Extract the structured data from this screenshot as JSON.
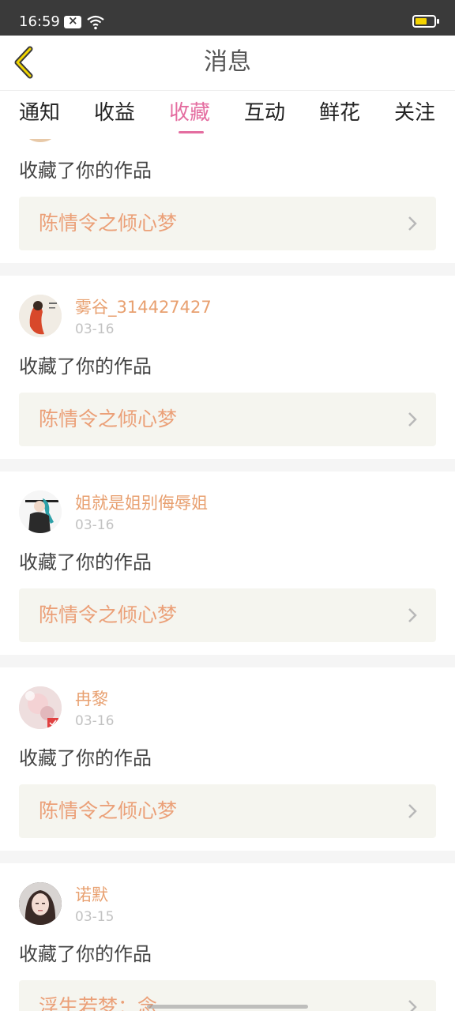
{
  "status_bar": {
    "time": "16:59"
  },
  "header": {
    "title": "消息"
  },
  "tabs": [
    {
      "label": "通知"
    },
    {
      "label": "收益"
    },
    {
      "label": "收藏",
      "active": true
    },
    {
      "label": "互动"
    },
    {
      "label": "鲜花"
    },
    {
      "label": "关注"
    }
  ],
  "colors": {
    "accent": "#e46da0",
    "username": "#e8a070",
    "work_title": "#eba078",
    "work_bg": "#f5f5ef"
  },
  "feed": {
    "partial_top": {
      "action": "收藏了你的作品",
      "work_title": "陈情令之倾心梦"
    },
    "items": [
      {
        "username": "雾谷_314427427",
        "date": "03-16",
        "action": "收藏了你的作品",
        "work_title": "陈情令之倾心梦"
      },
      {
        "username": "姐就是姐别侮辱姐",
        "date": "03-16",
        "action": "收藏了你的作品",
        "work_title": "陈情令之倾心梦"
      },
      {
        "username": "冉黎",
        "date": "03-16",
        "action": "收藏了你的作品",
        "work_title": "陈情令之倾心梦"
      },
      {
        "username": "诺默",
        "date": "03-15",
        "action": "收藏了你的作品",
        "work_title": "浮生若梦：念"
      }
    ]
  }
}
